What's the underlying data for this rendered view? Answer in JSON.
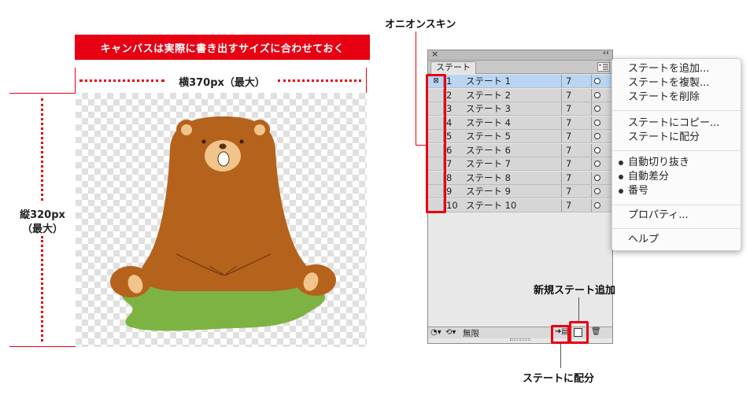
{
  "annotations": {
    "banner": "キャンバスは実際に書き出すサイズに合わせておく",
    "width_label": "横370px（最大）",
    "height_label_line1": "縦320px",
    "height_label_line2": "（最大）",
    "onion_skin": "オニオンスキン",
    "new_state": "新規ステート追加",
    "distribute": "ステートに配分"
  },
  "panel": {
    "close_glyph": "×",
    "collapse_glyph": "‹‹",
    "tab_label": "ステート",
    "states": [
      {
        "num": "1",
        "name": "ステート 1",
        "delay": "7"
      },
      {
        "num": "2",
        "name": "ステート 2",
        "delay": "7"
      },
      {
        "num": "3",
        "name": "ステート 3",
        "delay": "7"
      },
      {
        "num": "4",
        "name": "ステート 4",
        "delay": "7"
      },
      {
        "num": "5",
        "name": "ステート 5",
        "delay": "7"
      },
      {
        "num": "6",
        "name": "ステート 6",
        "delay": "7"
      },
      {
        "num": "7",
        "name": "ステート 7",
        "delay": "7"
      },
      {
        "num": "8",
        "name": "ステート 8",
        "delay": "7"
      },
      {
        "num": "9",
        "name": "ステート 9",
        "delay": "7"
      },
      {
        "num": "10",
        "name": "ステート 10",
        "delay": "7"
      }
    ],
    "loop_label": "無限"
  },
  "menu": {
    "group1": [
      "ステートを追加...",
      "ステートを複製...",
      "ステートを削除"
    ],
    "group2": [
      "ステートにコピー...",
      "ステートに配分"
    ],
    "group3": [
      "自動切り抜き",
      "自動差分",
      "番号"
    ],
    "group4": [
      "プロパティ..."
    ],
    "group5": [
      "ヘルプ"
    ]
  },
  "colors": {
    "accent_red": "#e60012",
    "bear_brown": "#b5621c",
    "grass_green": "#7cb342",
    "selection_blue": "#b9d5f3"
  }
}
